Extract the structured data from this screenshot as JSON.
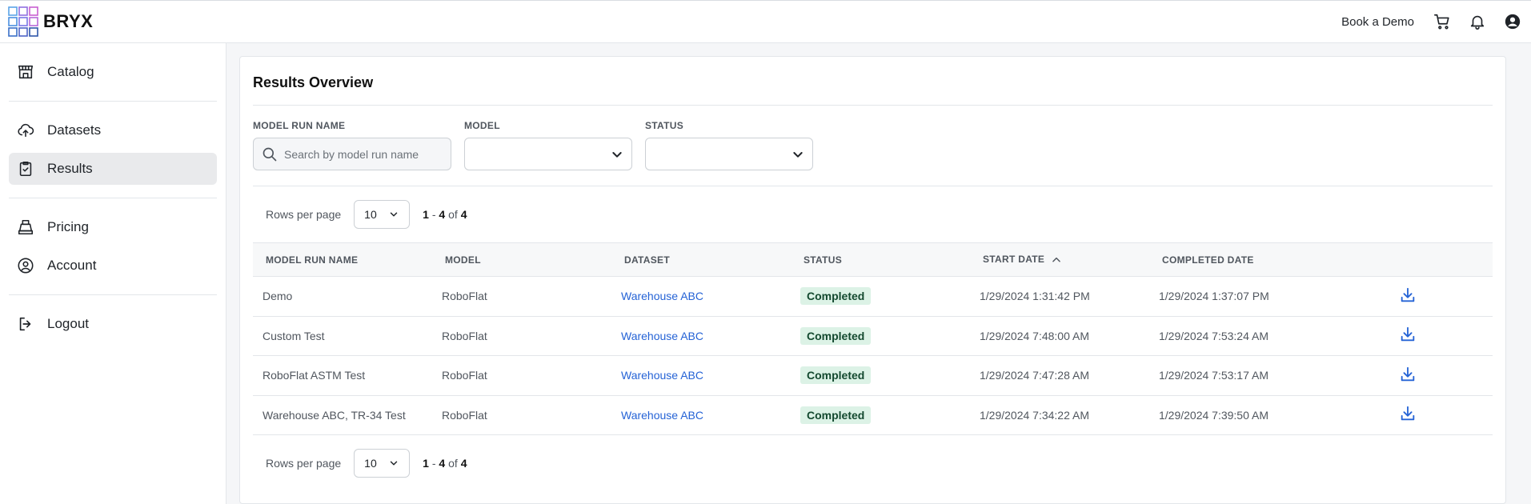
{
  "header": {
    "brand": "BRYX",
    "book_demo": "Book a Demo",
    "icons": [
      "cart-icon",
      "bell-icon",
      "user-circle-icon"
    ]
  },
  "sidebar": {
    "items": [
      {
        "label": "Catalog",
        "icon": "store-icon"
      },
      {
        "label": "Datasets",
        "icon": "cloud-upload-icon"
      },
      {
        "label": "Results",
        "icon": "clipboard-check-icon",
        "active": true
      },
      {
        "label": "Pricing",
        "icon": "cash-register-icon"
      },
      {
        "label": "Account",
        "icon": "user-circle-icon"
      },
      {
        "label": "Logout",
        "icon": "logout-icon"
      }
    ]
  },
  "main": {
    "title": "Results Overview",
    "filters": {
      "name_label": "MODEL RUN NAME",
      "name_placeholder": "Search by model run name",
      "model_label": "MODEL",
      "status_label": "STATUS"
    },
    "pager": {
      "rows_label": "Rows per page",
      "rows_value": "10",
      "range_start": "1",
      "range_end": "4",
      "range_sep": "-",
      "range_of": "of",
      "total": "4"
    },
    "table": {
      "columns": [
        "MODEL RUN NAME",
        "MODEL",
        "DATASET",
        "STATUS",
        "START DATE",
        "COMPLETED DATE"
      ],
      "rows": [
        {
          "name": "Demo",
          "model": "RoboFlat",
          "dataset": "Warehouse ABC",
          "status": "Completed",
          "start": "1/29/2024 1:31:42 PM",
          "completed": "1/29/2024 1:37:07 PM"
        },
        {
          "name": "Custom Test",
          "model": "RoboFlat",
          "dataset": "Warehouse ABC",
          "status": "Completed",
          "start": "1/29/2024 7:48:00 AM",
          "completed": "1/29/2024 7:53:24 AM"
        },
        {
          "name": "RoboFlat ASTM Test",
          "model": "RoboFlat",
          "dataset": "Warehouse ABC",
          "status": "Completed",
          "start": "1/29/2024 7:47:28 AM",
          "completed": "1/29/2024 7:53:17 AM"
        },
        {
          "name": "Warehouse ABC, TR-34 Test",
          "model": "RoboFlat",
          "dataset": "Warehouse ABC",
          "status": "Completed",
          "start": "1/29/2024 7:34:22 AM",
          "completed": "1/29/2024 7:39:50 AM"
        }
      ]
    }
  },
  "colors": {
    "link": "#2563d6",
    "badge_bg": "#dcf2e6",
    "badge_text": "#13492f",
    "active_nav": "#e9eaec"
  }
}
